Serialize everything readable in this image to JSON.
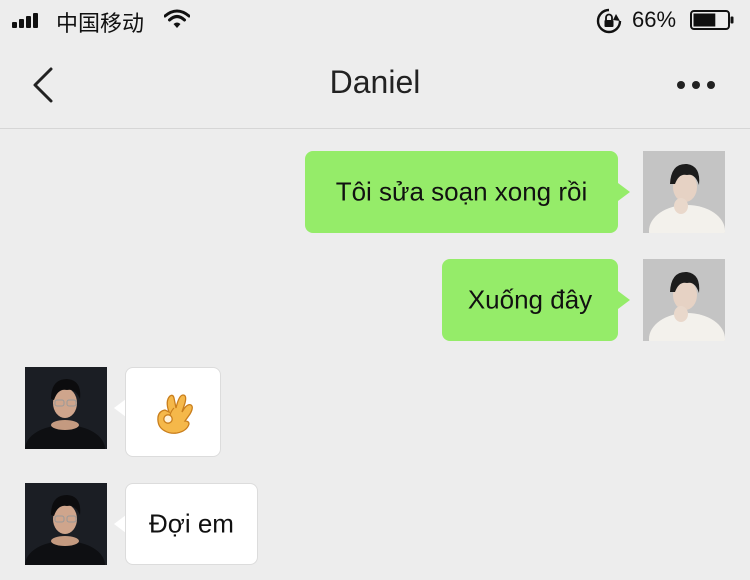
{
  "status_bar": {
    "carrier": "中国移动",
    "battery_percent_label": "66%",
    "battery_level": 0.66,
    "icons": [
      "signal-icon",
      "wifi-icon",
      "rotation-lock-icon",
      "battery-icon"
    ]
  },
  "nav": {
    "title": "Daniel",
    "back_icon": "chevron-left-icon",
    "more_icon": "more-dots-icon"
  },
  "colors": {
    "background": "#ededed",
    "outgoing_bubble": "#95ec69",
    "incoming_bubble": "#ffffff"
  },
  "messages": [
    {
      "direction": "outgoing",
      "text": "Tôi sửa soạn xong rồi"
    },
    {
      "direction": "outgoing",
      "text": "Xuống đây"
    },
    {
      "direction": "incoming",
      "emoji": "ok-hand-emoji"
    },
    {
      "direction": "incoming",
      "text": "Đợi em"
    }
  ]
}
